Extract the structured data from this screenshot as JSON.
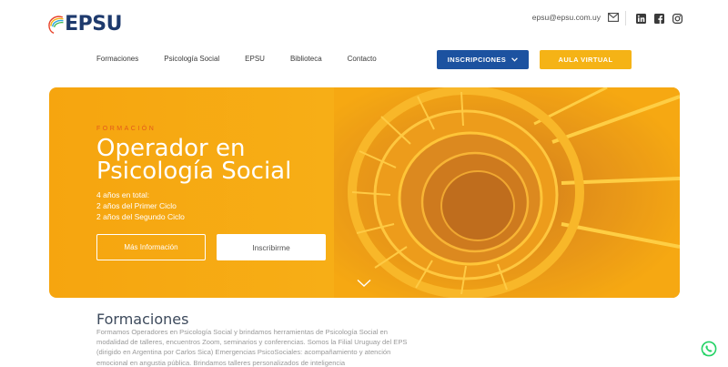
{
  "header": {
    "logo_text": "EPSU",
    "email": "epsu@epsu.com.uy",
    "icons": {
      "mail": "mail-icon",
      "linkedin": "linkedin-icon",
      "facebook": "facebook-icon",
      "instagram": "instagram-icon"
    }
  },
  "nav": {
    "items": [
      "Formaciones",
      "Psicología Social",
      "EPSU",
      "Biblioteca",
      "Contacto"
    ],
    "inscripciones_label": "INSCRIPCIONES",
    "aula_label": "AULA VIRTUAL"
  },
  "hero": {
    "kicker": "FORMACIÓN",
    "title": "Operador en Psicología Social",
    "lines": [
      "4 años en total:",
      "2 años del Primer Ciclo",
      "2 años del Segundo Ciclo"
    ],
    "btn_more": "Más Información",
    "btn_signup": "Inscribirme"
  },
  "section": {
    "title": "Formaciones",
    "text": "Formamos Operadores en Psicología Social y brindamos herramientas de Psicología Social en modalidad de talleres, encuentros Zoom, seminarios y conferencias. Somos la Filial Uruguay del EPS (dirigido en Argentina por Carlos Sica) Emergencias PsicoSociales: acompañamiento y atención emocional en angustia pública. Brindamos talleres personalizados de inteligencia"
  },
  "colors": {
    "brand_blue": "#1c52a0",
    "brand_yellow": "#f5b316",
    "hero_orange": "#f6a50f",
    "accent_orange": "#e25a1c"
  }
}
